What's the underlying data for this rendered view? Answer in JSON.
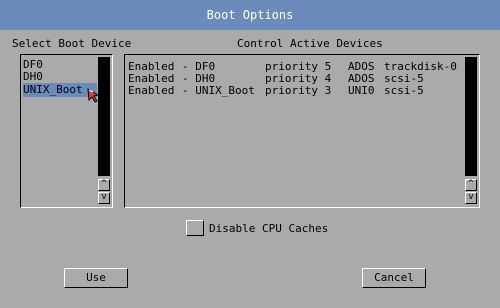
{
  "window": {
    "title": "Boot Options"
  },
  "left_panel": {
    "label": "Select Boot Device",
    "items": [
      "DF0",
      "DH0",
      "UNIX_Boot"
    ],
    "selected_index": 2
  },
  "right_panel": {
    "label": "Control Active Devices",
    "devices": [
      {
        "status": "Enabled",
        "name": "- DF0",
        "priority": "priority 5",
        "dostype": "ADOS",
        "driver": "trackdisk-0"
      },
      {
        "status": "Enabled",
        "name": "- DH0",
        "priority": "priority 4",
        "dostype": "ADOS",
        "driver": "scsi-5"
      },
      {
        "status": "Enabled",
        "name": "- UNIX_Boot",
        "priority": "priority 3",
        "dostype": "UNI0",
        "driver": "scsi-5"
      }
    ]
  },
  "options": {
    "disable_cpu_caches_label": "Disable CPU Caches",
    "disable_cpu_caches_checked": false
  },
  "buttons": {
    "use_label": "Use",
    "cancel_label": "Cancel"
  },
  "scroll": {
    "up_glyph": "^",
    "down_glyph": "v"
  },
  "colors": {
    "background": "#aaaaaa",
    "title_bar": "#6b8bba",
    "selection": "#6b8bba",
    "title_text": "#ffffff"
  }
}
